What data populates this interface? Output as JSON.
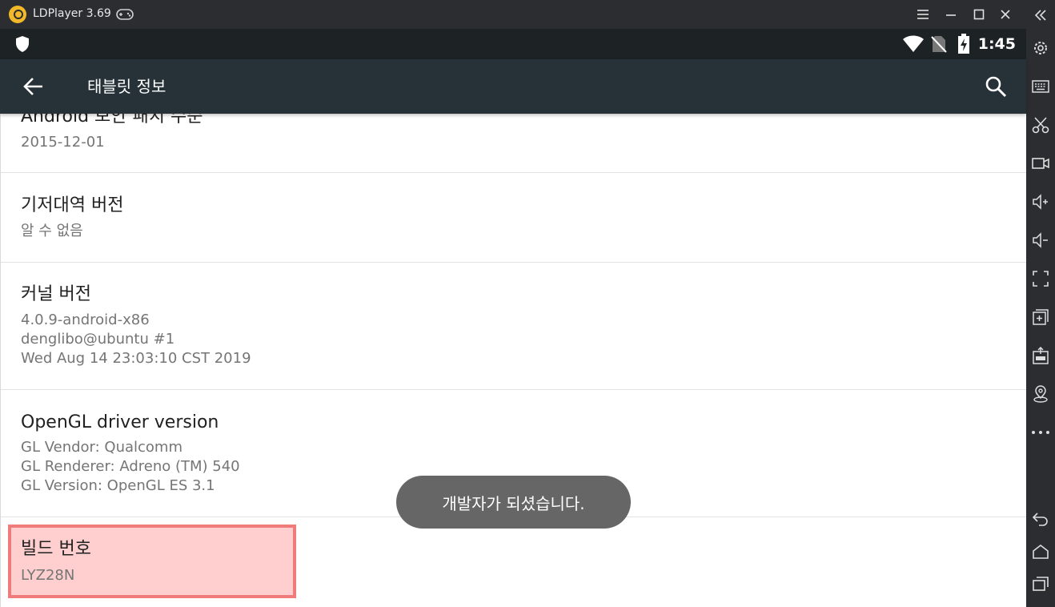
{
  "window": {
    "app_title": "LDPlayer 3.69",
    "buttons": [
      "menu",
      "minimize",
      "maximize",
      "close"
    ]
  },
  "status_bar": {
    "time": "1:45"
  },
  "action_bar": {
    "title": "태블릿 정보"
  },
  "settings_items": [
    {
      "title": "Android 보안 패치 수준",
      "lines": [
        "2015-12-01"
      ]
    },
    {
      "title": "기저대역 버전",
      "lines": [
        "알 수 없음"
      ]
    },
    {
      "title": "커널 버전",
      "lines": [
        "4.0.9-android-x86",
        "denglibo@ubuntu #1",
        "Wed Aug 14 23:03:10 CST 2019"
      ]
    },
    {
      "title": "OpenGL driver version",
      "lines": [
        "GL Vendor: Qualcomm",
        "GL Renderer: Adreno (TM) 540",
        "GL Version: OpenGL ES 3.1"
      ]
    },
    {
      "title": "빌드 번호",
      "lines": [
        "LYZ28N"
      ]
    }
  ],
  "toast": {
    "message": "개발자가 되셨습니다."
  },
  "sidebar_icons": [
    "collapse-icon",
    "settings-icon",
    "keyboard-icon",
    "scissors-icon",
    "video-record-icon",
    "volume-up-icon",
    "volume-down-icon",
    "fullscreen-icon",
    "add-window-icon",
    "apk-install-icon",
    "location-icon",
    "more-icon",
    "back-icon",
    "home-icon",
    "recents-icon"
  ],
  "colors": {
    "titlebar": "#2b2d31",
    "statusbar": "#1d2224",
    "actionbar": "#263238",
    "highlight_border": "#ef7b7b",
    "toast": "#666666"
  }
}
